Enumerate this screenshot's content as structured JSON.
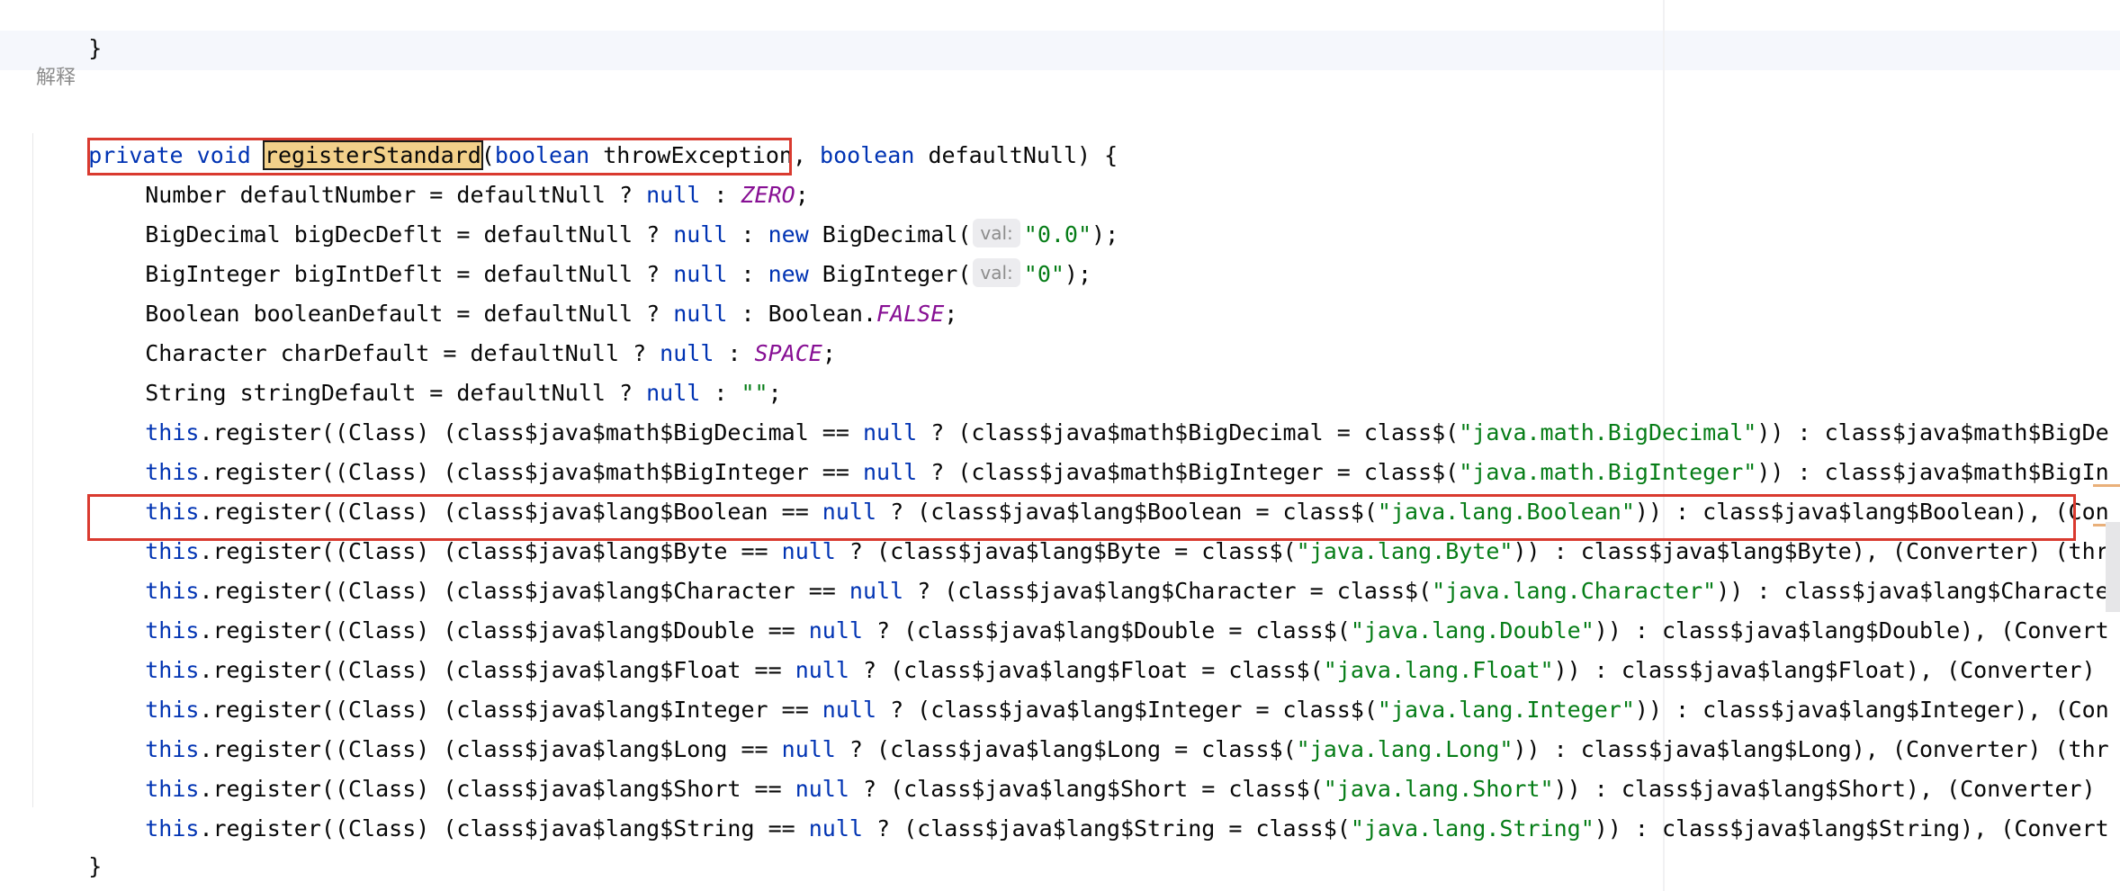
{
  "editor": {
    "doc_label": "解释",
    "lines": [
      {
        "text": "}"
      },
      {
        "kw1": "private",
        "kw2": "void",
        "method": "registerStandard",
        "p1": "(",
        "kw3": "boolean",
        "p2": " throwException, ",
        "kw4": "boolean",
        "p3": " defaultNull) {"
      },
      {
        "a": "Number defaultNumber = defaultNull ? ",
        "kw": "null",
        "b": " : ",
        "c": "ZERO",
        "d": ";"
      },
      {
        "a": "BigDecimal bigDecDeflt = defaultNull ? ",
        "kw1": "null",
        "b": " : ",
        "kw2": "new",
        "c": " BigDecimal(",
        "hint": "val:",
        "s": "\"0.0\"",
        "d": ");"
      },
      {
        "a": "BigInteger bigIntDeflt = defaultNull ? ",
        "kw1": "null",
        "b": " : ",
        "kw2": "new",
        "c": " BigInteger(",
        "hint": "val:",
        "s": "\"0\"",
        "d": ");"
      },
      {
        "a": "Boolean booleanDefault = defaultNull ? ",
        "kw": "null",
        "b": " : Boolean.",
        "c": "FALSE",
        "d": ";"
      },
      {
        "a": "Character charDefault = defaultNull ? ",
        "kw": "null",
        "b": " : ",
        "c": "SPACE",
        "d": ";"
      },
      {
        "a": "String stringDefault = defaultNull ? ",
        "kw": "null",
        "b": " : ",
        "s": "\"\"",
        "d": ";"
      },
      {
        "this": "this",
        "a": ".register((Class) (class$java$math$BigDecimal == ",
        "kw": "null",
        "b": " ? (class$java$math$BigDecimal = class$(",
        "s": "\"java.math.BigDecimal\"",
        "c": ")) : class$java$math$BigDe"
      },
      {
        "this": "this",
        "a": ".register((Class) (class$java$math$BigInteger == ",
        "kw": "null",
        "b": " ? (class$java$math$BigInteger = class$(",
        "s": "\"java.math.BigInteger\"",
        "c": ")) : class$java$math$BigIn"
      },
      {
        "this": "this",
        "a": ".register((Class) (class$java$lang$Boolean == ",
        "kw": "null",
        "b": " ? (class$java$lang$Boolean = class$(",
        "s": "\"java.lang.Boolean\"",
        "c": ")) : class$java$lang$Boolean), (Con"
      },
      {
        "this": "this",
        "a": ".register((Class) (class$java$lang$Byte == ",
        "kw": "null",
        "b": " ? (class$java$lang$Byte = class$(",
        "s": "\"java.lang.Byte\"",
        "c": ")) : class$java$lang$Byte), (Converter) (thr"
      },
      {
        "this": "this",
        "a": ".register((Class) (class$java$lang$Character == ",
        "kw": "null",
        "b": " ? (class$java$lang$Character = class$(",
        "s": "\"java.lang.Character\"",
        "c": ")) : class$java$lang$Characte"
      },
      {
        "this": "this",
        "a": ".register((Class) (class$java$lang$Double == ",
        "kw": "null",
        "b": " ? (class$java$lang$Double = class$(",
        "s": "\"java.lang.Double\"",
        "c": ")) : class$java$lang$Double), (Convert"
      },
      {
        "this": "this",
        "a": ".register((Class) (class$java$lang$Float == ",
        "kw": "null",
        "b": " ? (class$java$lang$Float = class$(",
        "s": "\"java.lang.Float\"",
        "c": ")) : class$java$lang$Float), (Converter) "
      },
      {
        "this": "this",
        "a": ".register((Class) (class$java$lang$Integer == ",
        "kw": "null",
        "b": " ? (class$java$lang$Integer = class$(",
        "s": "\"java.lang.Integer\"",
        "c": ")) : class$java$lang$Integer), (Con"
      },
      {
        "this": "this",
        "a": ".register((Class) (class$java$lang$Long == ",
        "kw": "null",
        "b": " ? (class$java$lang$Long = class$(",
        "s": "\"java.lang.Long\"",
        "c": ")) : class$java$lang$Long), (Converter) (thr"
      },
      {
        "this": "this",
        "a": ".register((Class) (class$java$lang$Short == ",
        "kw": "null",
        "b": " ? (class$java$lang$Short = class$(",
        "s": "\"java.lang.Short\"",
        "c": ")) : class$java$lang$Short), (Converter) "
      },
      {
        "this": "this",
        "a": ".register((Class) (class$java$lang$String == ",
        "kw": "null",
        "b": " ? (class$java$lang$String = class$(",
        "s": "\"java.lang.String\"",
        "c": ")) : class$java$lang$String), (Convert"
      },
      {
        "text": "}"
      }
    ]
  },
  "colors": {
    "keyword": "#0033b3",
    "string": "#067d17",
    "constant": "#871094",
    "highlight": "#f2d08a",
    "annotation_box": "#d93a2f"
  }
}
